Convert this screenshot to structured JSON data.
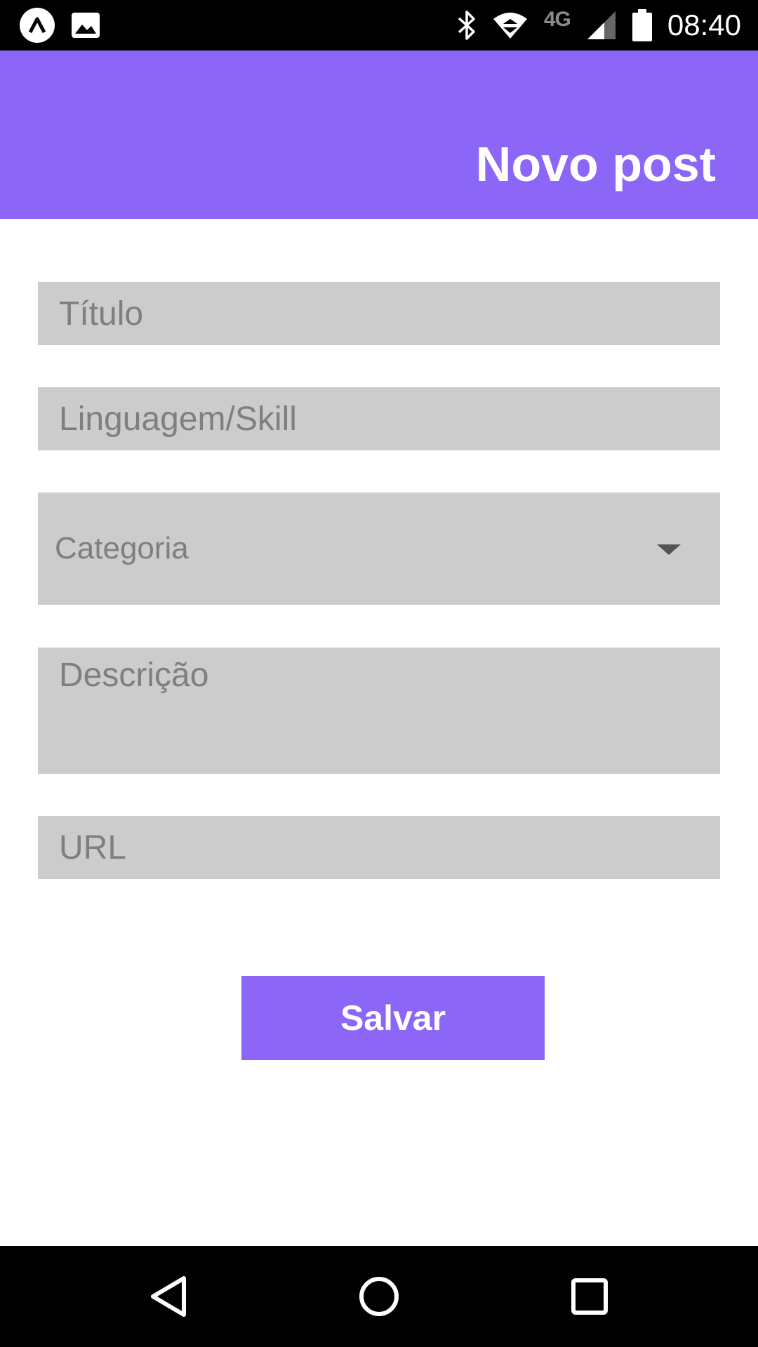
{
  "status_bar": {
    "left_icons": [
      "app-notification-icon",
      "image-notification-icon"
    ],
    "right_icons": [
      "bluetooth-icon",
      "wifi-icon",
      "signal-icon",
      "battery-icon"
    ],
    "network": "4G",
    "time": "08:40"
  },
  "header": {
    "title": "Novo post",
    "background_color": "#8c66f7"
  },
  "form": {
    "title_placeholder": "Título",
    "skill_placeholder": "Linguagem/Skill",
    "category_placeholder": "Categoria",
    "description_placeholder": "Descrição",
    "url_placeholder": "URL",
    "field_background_color": "#cccccc"
  },
  "actions": {
    "save_label": "Salvar"
  },
  "nav_bar": {
    "icons": [
      "back-icon",
      "home-icon",
      "recents-icon"
    ]
  }
}
